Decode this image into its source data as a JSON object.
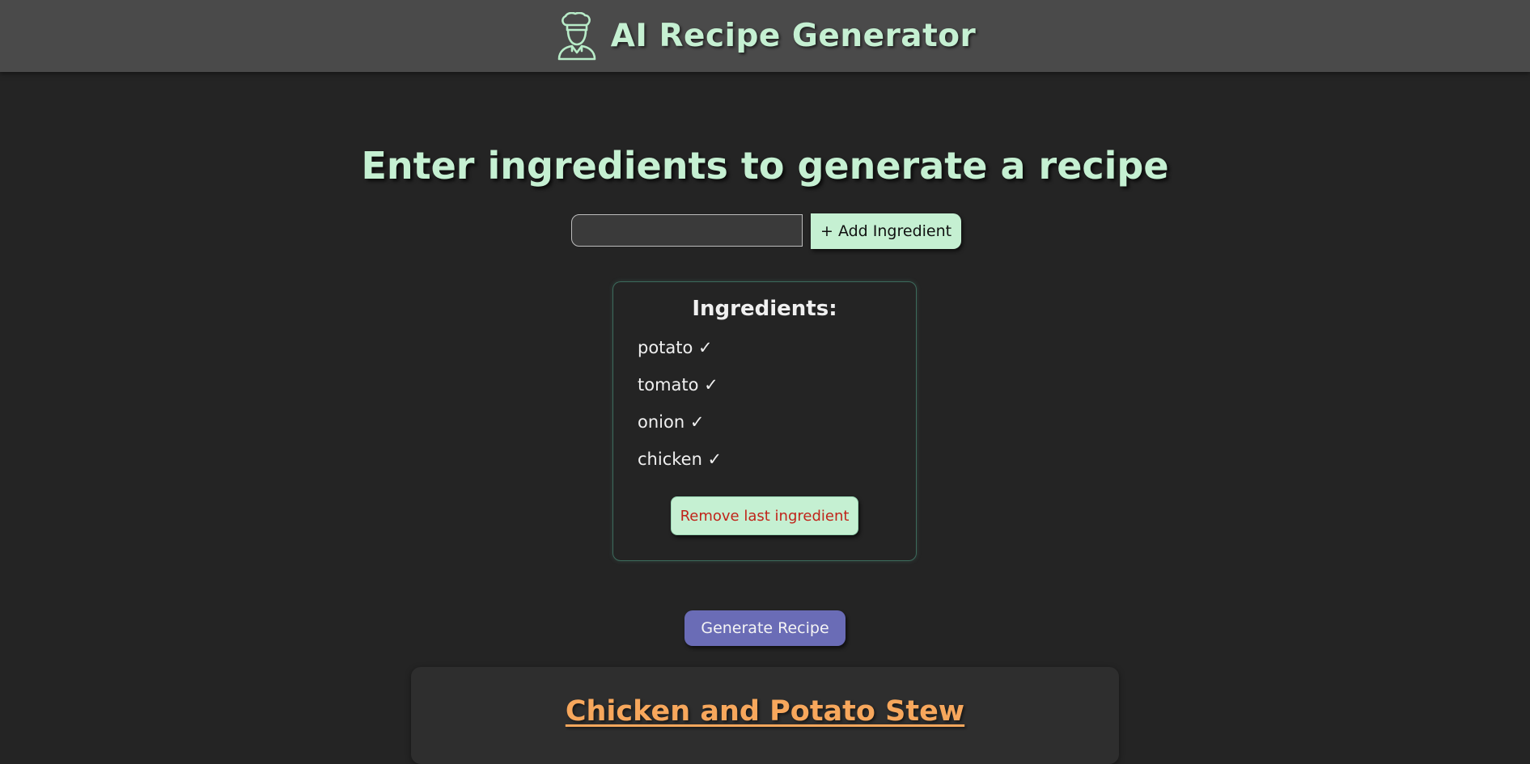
{
  "header": {
    "icon": "chef-icon",
    "title": "AI Recipe Generator"
  },
  "main": {
    "heading": "Enter ingredients to generate a recipe",
    "ingredient_input": {
      "value": "",
      "placeholder": ""
    },
    "add_button_label": "+ Add Ingredient"
  },
  "ingredients_panel": {
    "title": "Ingredients:",
    "items": [
      {
        "label": "potato ✓"
      },
      {
        "label": "tomato ✓"
      },
      {
        "label": "onion ✓"
      },
      {
        "label": "chicken ✓"
      }
    ],
    "remove_button_label": "Remove last ingredient"
  },
  "generate_button_label": "Generate Recipe",
  "recipe": {
    "title": "Chicken and Potato Stew"
  },
  "colors": {
    "background": "#242424",
    "header": "#4a4a4a",
    "accent_mint": "#c5f0d2",
    "remove_text": "#c0241a",
    "generate_button": "#6a6cb6",
    "recipe_title": "#f7a75c"
  }
}
